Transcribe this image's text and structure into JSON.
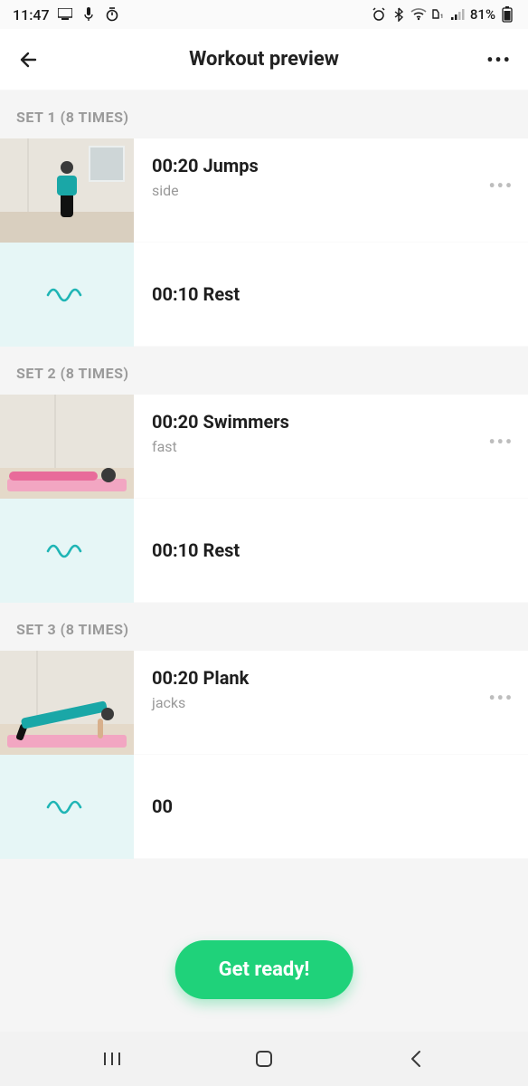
{
  "status": {
    "time": "11:47",
    "battery": "81%"
  },
  "header": {
    "title": "Workout preview"
  },
  "sets": [
    {
      "label": "SET 1 (8 TIMES)",
      "exercise": {
        "title": "00:20 Jumps",
        "sub": "side"
      },
      "rest": {
        "title": "00:10 Rest"
      }
    },
    {
      "label": "SET 2 (8 TIMES)",
      "exercise": {
        "title": "00:20 Swimmers",
        "sub": "fast"
      },
      "rest": {
        "title": "00:10 Rest"
      }
    },
    {
      "label": "SET 3 (8 TIMES)",
      "exercise": {
        "title": "00:20 Plank",
        "sub": "jacks"
      },
      "rest": {
        "title": "00"
      }
    }
  ],
  "cta": {
    "label": "Get ready!"
  }
}
